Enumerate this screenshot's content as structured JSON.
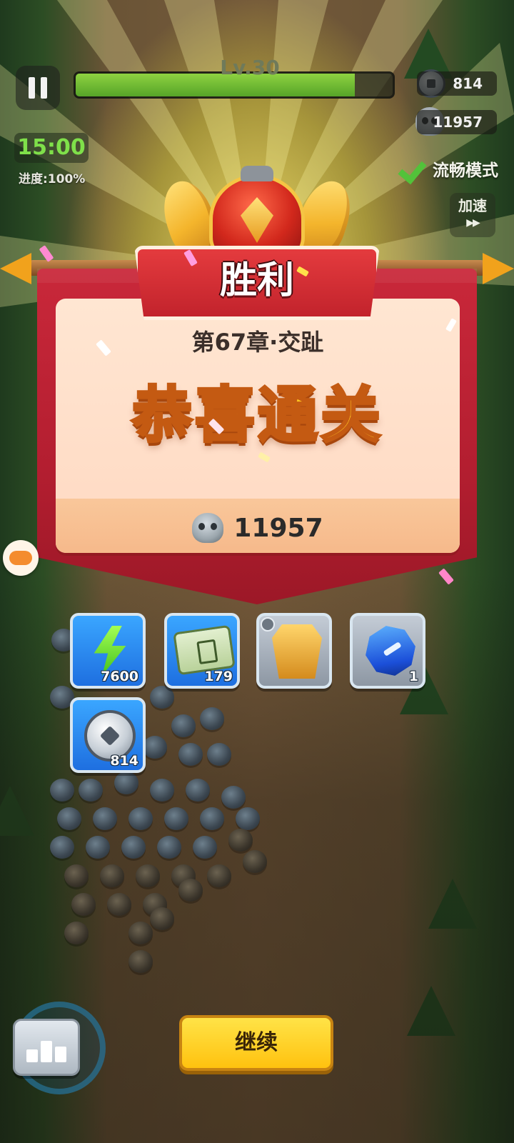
{
  "hud": {
    "level_label": "Lv.30",
    "level_progress": 0.88,
    "coins": "814",
    "skulls": "11957",
    "timer": "15:00",
    "progress": "进度:100%",
    "smooth_mode_label": "流畅模式",
    "speed_label": "加速",
    "speed_arrows": "▶▶"
  },
  "result": {
    "title": "胜利",
    "chapter": "第67章·交趾",
    "headline": "恭喜通关",
    "reward_value": "11957"
  },
  "rewards": [
    {
      "icon": "energy-bolt-icon",
      "count": "7600",
      "frame": "blue"
    },
    {
      "icon": "scroll-icon",
      "count": "179",
      "frame": "blue"
    },
    {
      "icon": "golden-armor-icon",
      "count": "",
      "frame": "grey"
    },
    {
      "icon": "blue-gem-icon",
      "count": "1",
      "frame": "grey"
    },
    {
      "icon": "silver-coin-icon",
      "count": "814",
      "frame": "blue"
    }
  ],
  "buttons": {
    "continue": "继续"
  },
  "colors": {
    "banner_red": "#c9283a",
    "headline_gold": "#ffc421",
    "timer_green": "#7fe04a",
    "continue_yellow": "#ffd22b"
  }
}
